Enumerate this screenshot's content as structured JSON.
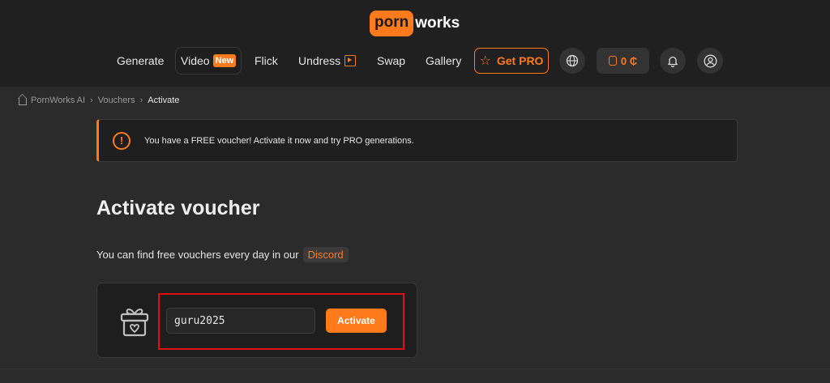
{
  "logo": {
    "badge": "porn",
    "text": "works"
  },
  "nav": {
    "items": [
      "Generate",
      "Video",
      "Flick",
      "Undress",
      "Swap",
      "Gallery"
    ],
    "new_badge": "New",
    "get_pro": "Get PRO",
    "coins": "0 ₵"
  },
  "breadcrumb": {
    "home": "PornWorks AI",
    "parent": "Vouchers",
    "current": "Activate"
  },
  "alert": {
    "text": "You have a FREE voucher! Activate it now and try PRO generations."
  },
  "page": {
    "title": "Activate voucher",
    "find_text": "You can find free vouchers every day in our",
    "discord": "Discord"
  },
  "voucher": {
    "code": "guru2025",
    "button": "Activate"
  },
  "colors": {
    "accent": "#ff7a1a",
    "highlight": "#e01010",
    "background": "#2b2b2b",
    "header": "#202020"
  },
  "icons": [
    "home-icon",
    "chevron-right-icon",
    "alert-circle-icon",
    "gift-icon",
    "star-icon",
    "globe-icon",
    "coins-icon",
    "bell-icon",
    "user-icon",
    "play-square-icon"
  ]
}
